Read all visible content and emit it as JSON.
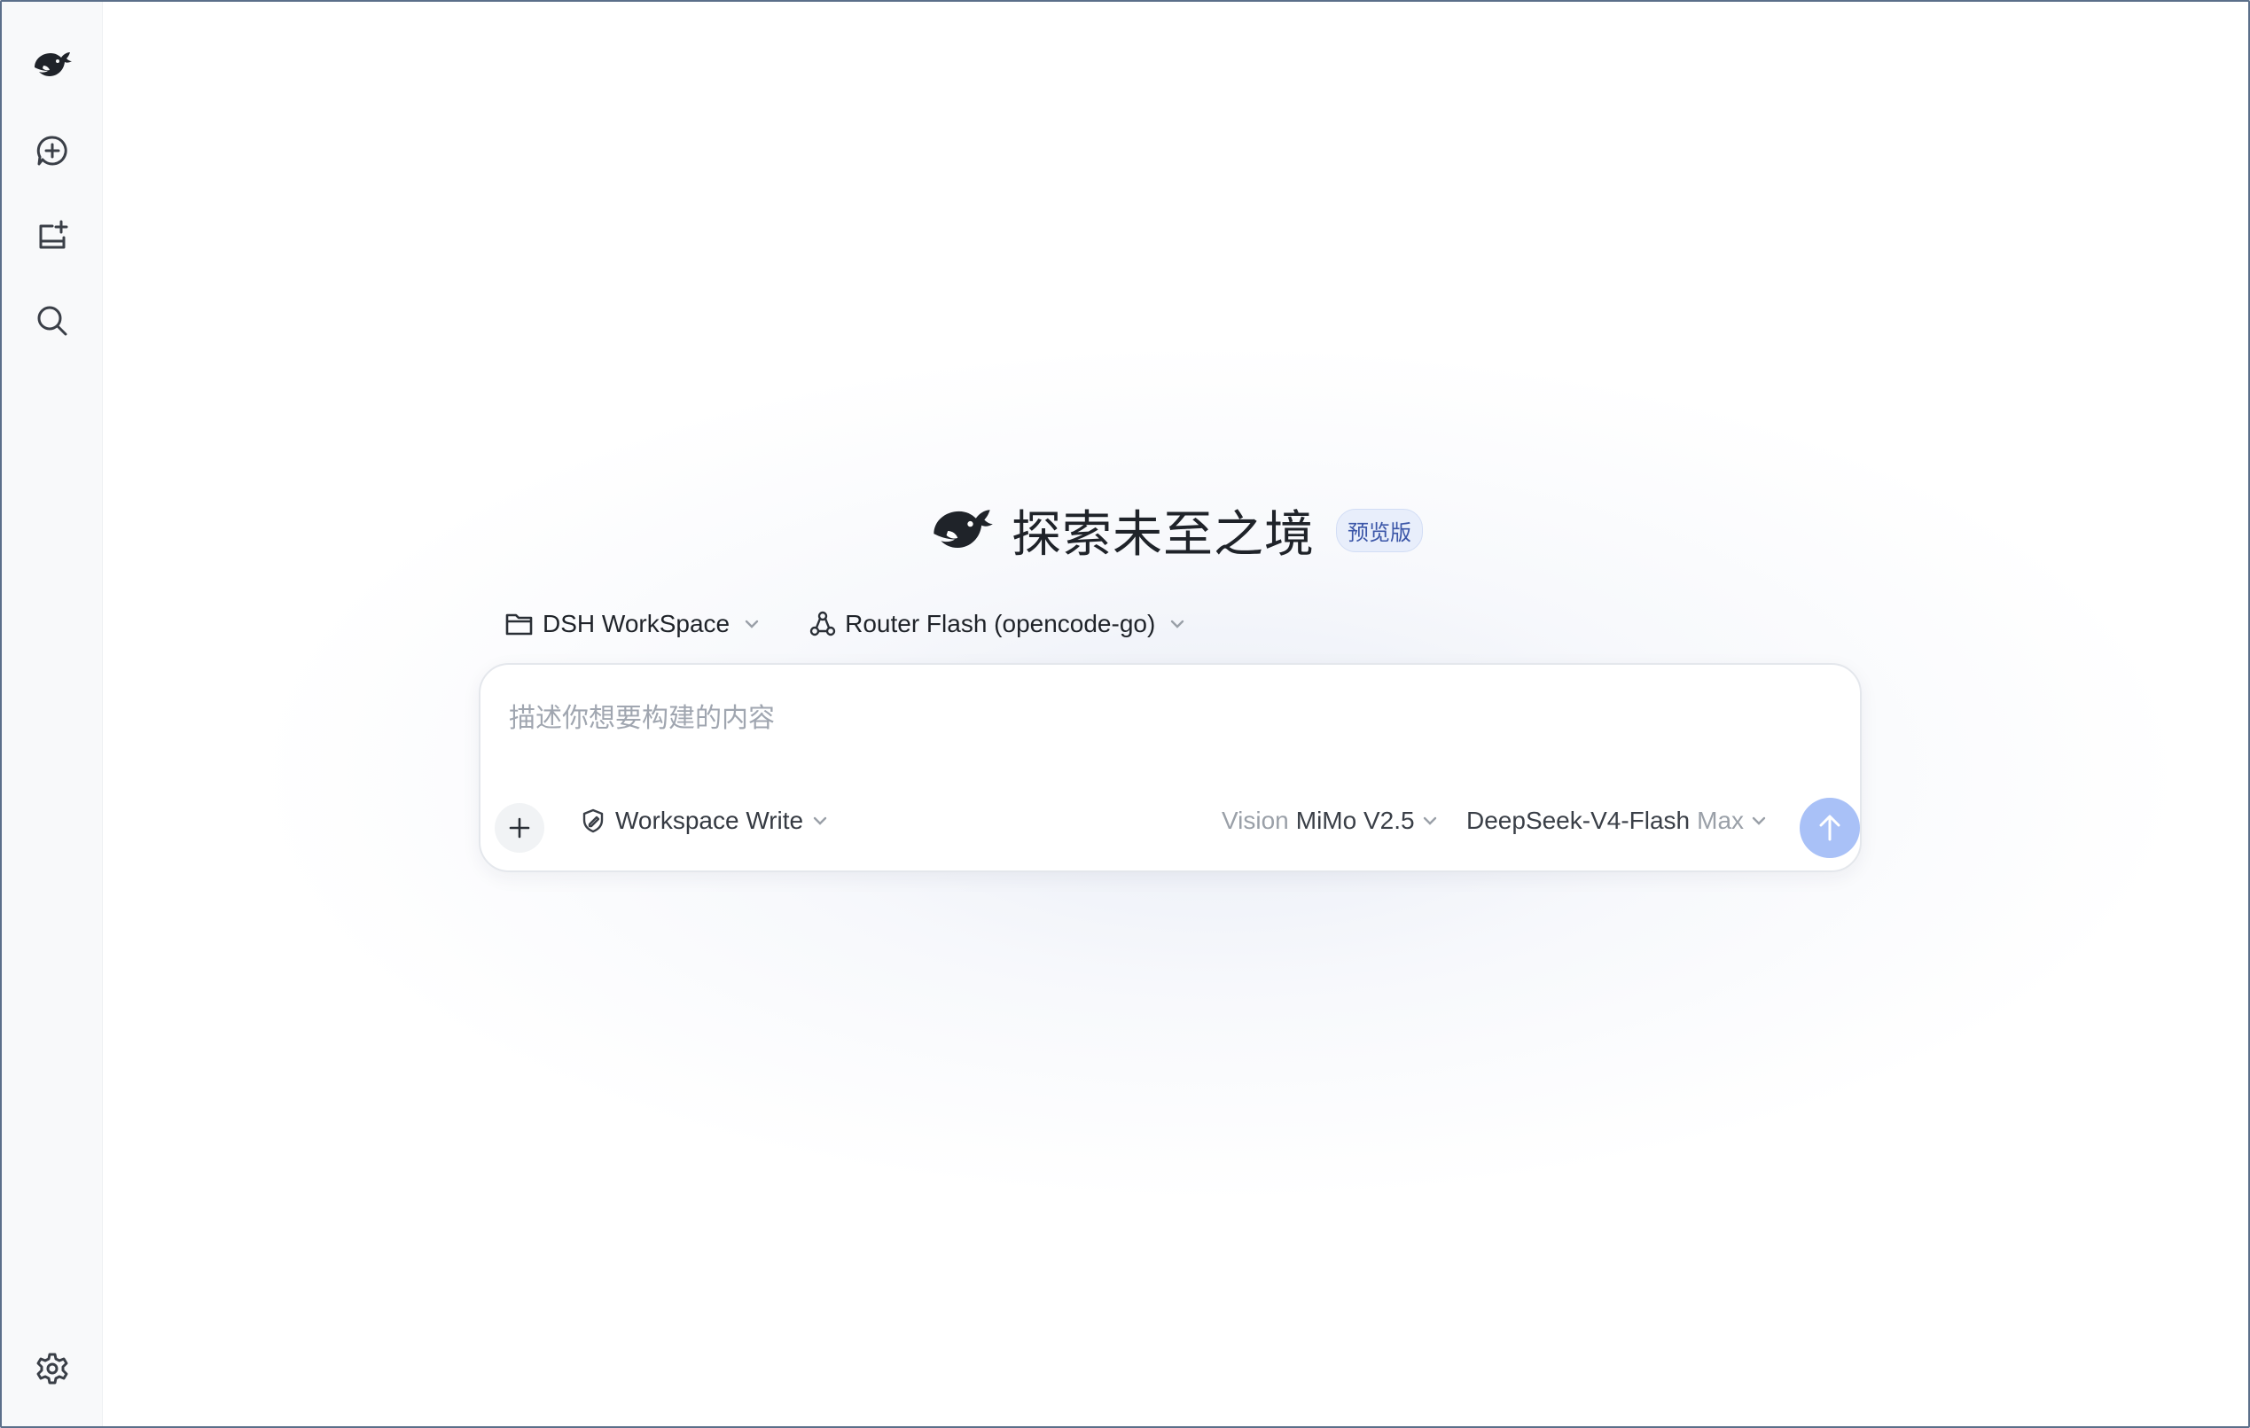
{
  "sidebar": {
    "items": [
      {
        "icon": "whale-logo-icon"
      },
      {
        "icon": "new-chat-icon"
      },
      {
        "icon": "new-project-icon"
      },
      {
        "icon": "search-icon"
      }
    ],
    "footer_icon": "gear-icon"
  },
  "hero": {
    "title": "探索未至之境",
    "badge": "预览版"
  },
  "pickers": {
    "workspace": "DSH WorkSpace",
    "router": "Router Flash (opencode-go)"
  },
  "composer": {
    "placeholder": "描述你想要构建的内容",
    "mode": "Workspace Write",
    "vision_prefix": "Vision",
    "vision_model": "MiMo V2.5",
    "model": "DeepSeek-V4-Flash",
    "model_suffix": "Max"
  },
  "colors": {
    "accent": "#a9c1f7",
    "badge_bg": "#e8eefb",
    "badge_text": "#3b56a8"
  }
}
